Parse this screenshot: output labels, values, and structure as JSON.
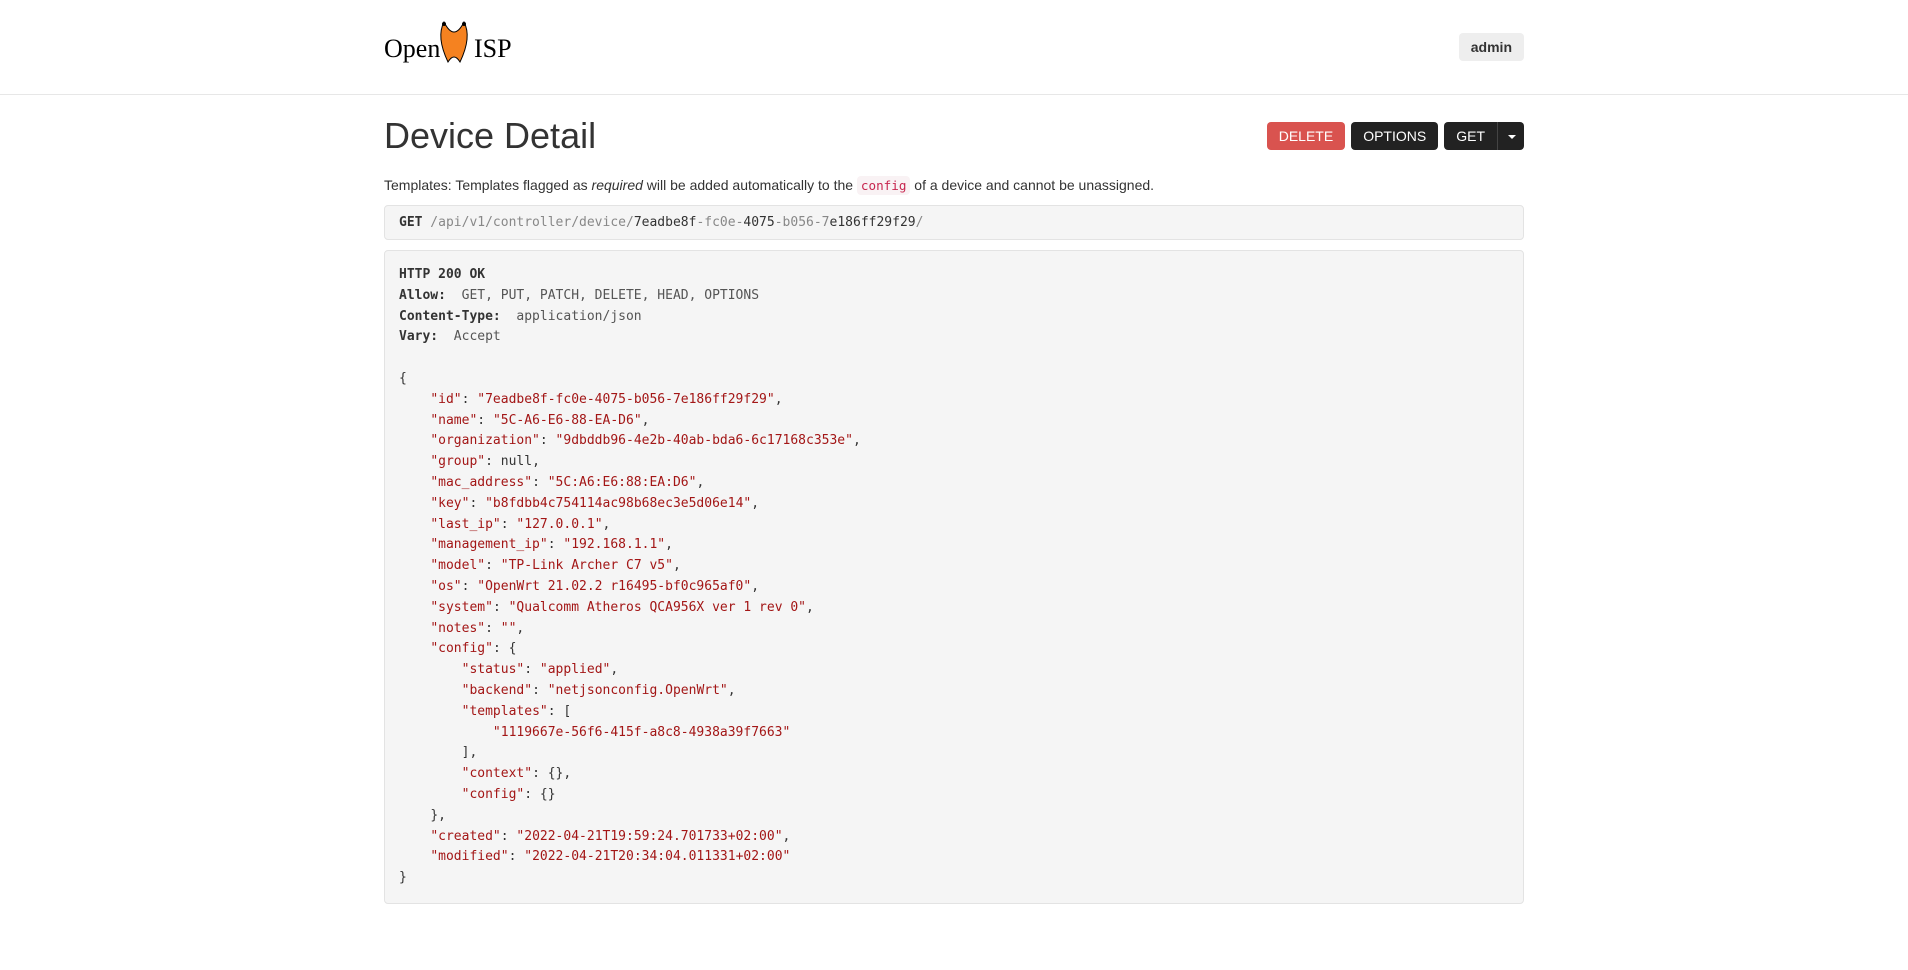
{
  "nav": {
    "brand": "OpenWISP",
    "admin": "admin"
  },
  "page": {
    "title": "Device Detail",
    "description_prefix": "Templates: Templates flagged as ",
    "description_emph": "required",
    "description_mid": " will be added automatically to the ",
    "description_code": "config",
    "description_suffix": " of a device and cannot be unassigned."
  },
  "buttons": {
    "delete": "DELETE",
    "options": "OPTIONS",
    "get": "GET"
  },
  "request": {
    "method": "GET",
    "path_prefix": " /api/v1/controller/device/",
    "path_seg1": "7eadbe8f",
    "path_seg2": "-fc0e-",
    "path_seg3": "4075",
    "path_seg4": "-b056-7",
    "path_seg5": "e186ff29f29",
    "path_seg6": "/"
  },
  "response_headers": {
    "status": "HTTP 200 OK",
    "allow_label": "Allow:",
    "allow_value": "  GET, PUT, PATCH, DELETE, HEAD, OPTIONS",
    "ctype_label": "Content-Type:",
    "ctype_value": "  application/json",
    "vary_label": "Vary:",
    "vary_value": "  Accept"
  },
  "json_body": {
    "id": "7eadbe8f-fc0e-4075-b056-7e186ff29f29",
    "name": "5C-A6-E6-88-EA-D6",
    "organization": "9dbddb96-4e2b-40ab-bda6-6c17168c353e",
    "group": null,
    "mac_address": "5C:A6:E6:88:EA:D6",
    "key": "b8fdbb4c754114ac98b68ec3e5d06e14",
    "last_ip": "127.0.0.1",
    "management_ip": "192.168.1.1",
    "model": "TP-Link Archer C7 v5",
    "os": "OpenWrt 21.02.2 r16495-bf0c965af0",
    "system": "Qualcomm Atheros QCA956X ver 1 rev 0",
    "notes": "",
    "config": {
      "status": "applied",
      "backend": "netjsonconfig.OpenWrt",
      "templates": [
        "1119667e-56f6-415f-a8c8-4938a39f7663"
      ],
      "context": {},
      "config": {}
    },
    "created": "2022-04-21T19:59:24.701733+02:00",
    "modified": "2022-04-21T20:34:04.011331+02:00"
  }
}
